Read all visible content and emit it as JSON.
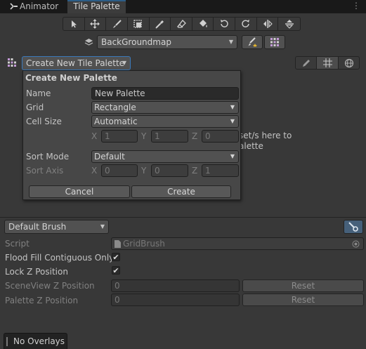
{
  "tabs": {
    "animator": "Animator",
    "tile_palette": "Tile Palette"
  },
  "toolbar": {
    "tools": [
      "select",
      "move",
      "paint",
      "box-fill",
      "pick",
      "erase",
      "flood-fill",
      "rotate-ccw",
      "rotate-cw",
      "flip-x",
      "flip-y"
    ]
  },
  "target": {
    "label": "BackGroundmap"
  },
  "palette_dropdown": {
    "label": "Create New Tile Palette"
  },
  "create_palette": {
    "title": "Create New Palette",
    "name_label": "Name",
    "name_value": "New Palette",
    "grid_label": "Grid",
    "grid_value": "Rectangle",
    "cell_size_label": "Cell Size",
    "cell_size_value": "Automatic",
    "cell": {
      "x_label": "X",
      "x": "1",
      "y_label": "Y",
      "y": "1",
      "z_label": "Z",
      "z": "0"
    },
    "sort_mode_label": "Sort Mode",
    "sort_mode_value": "Default",
    "sort_axis_label": "Sort Axis",
    "axis": {
      "x_label": "X",
      "x": "0",
      "y_label": "Y",
      "y": "0",
      "z_label": "Z",
      "z": "1"
    },
    "cancel": "Cancel",
    "create": "Create"
  },
  "hint": {
    "line1": "set/s here to",
    "line2": "alette"
  },
  "brush": {
    "dropdown": "Default Brush",
    "script_label": "Script",
    "script_value": "GridBrush",
    "flood_fill_label": "Flood Fill Contiguous Only",
    "flood_fill": true,
    "lock_z_label": "Lock Z Position",
    "lock_z": true,
    "sceneview_z_label": "SceneView Z Position",
    "sceneview_z": "0",
    "palette_z_label": "Palette Z Position",
    "palette_z": "0",
    "reset": "Reset"
  },
  "overlays": {
    "label": "No Overlays"
  },
  "colors": {
    "accent": "#2c5d87",
    "background": "#383838",
    "panel": "#474747"
  }
}
